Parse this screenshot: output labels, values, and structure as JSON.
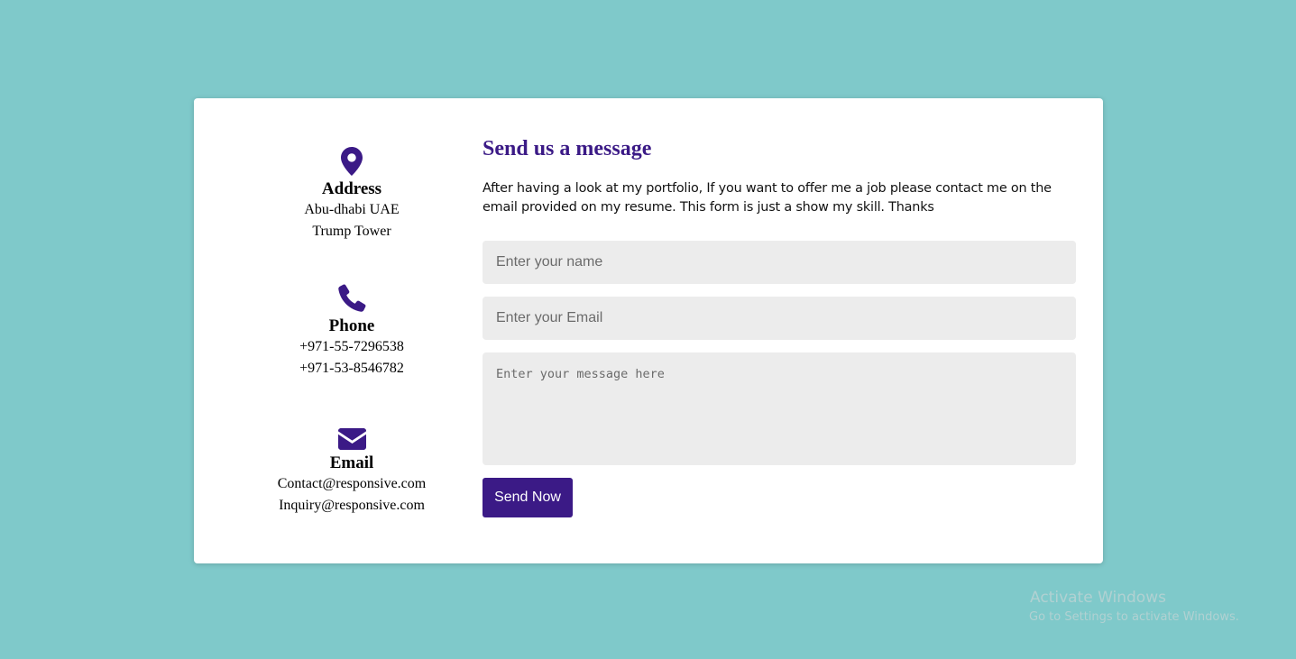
{
  "contact_info": {
    "address": {
      "icon": "map-pin-icon",
      "title": "Address",
      "lines": [
        "Abu-dhabi UAE",
        "Trump Tower"
      ]
    },
    "phone": {
      "icon": "phone-icon",
      "title": "Phone",
      "lines": [
        "+971-55-7296538",
        "+971-53-8546782"
      ]
    },
    "email": {
      "icon": "envelope-icon",
      "title": "Email",
      "lines": [
        "Contact@responsive.com",
        "Inquiry@responsive.com"
      ]
    }
  },
  "form": {
    "title": "Send us a message",
    "description": "After having a look at my portfolio, If you want to offer me a job please contact me on the email provided on my resume. This form is just a show my skill. Thanks",
    "name_placeholder": "Enter your name",
    "email_placeholder": "Enter your Email",
    "message_placeholder": "Enter your message here",
    "submit_label": "Send Now"
  },
  "watermark": {
    "title": "Activate Windows",
    "subtitle": "Go to Settings to activate Windows."
  },
  "colors": {
    "background": "#7fc9ca",
    "accent": "#3b1a86",
    "field_bg": "#ececec"
  }
}
